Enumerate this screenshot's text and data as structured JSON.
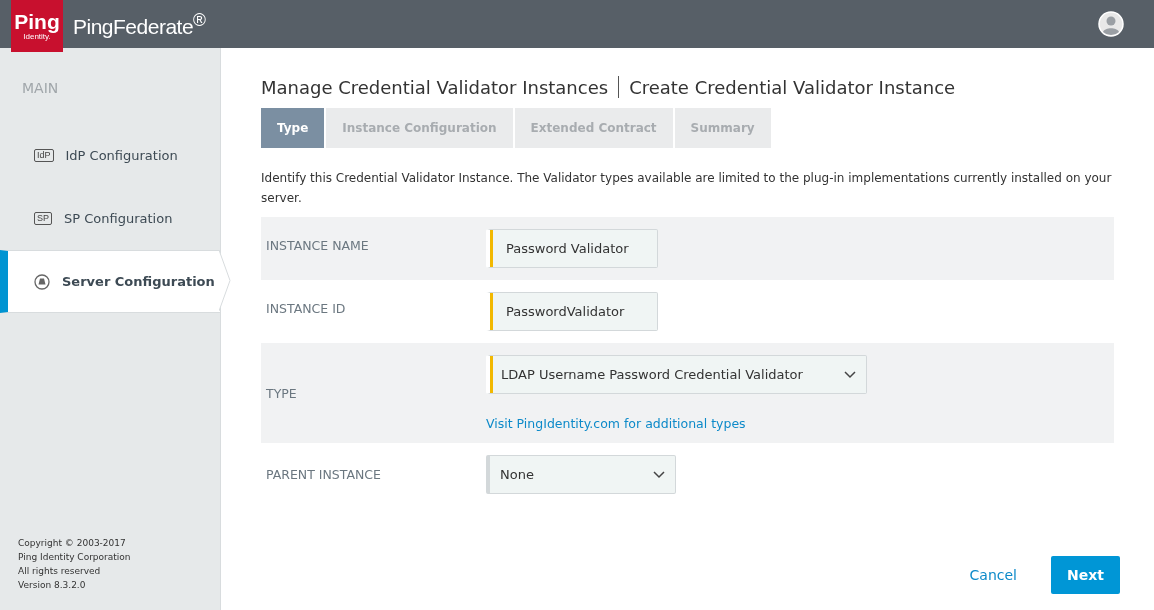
{
  "header": {
    "logo": {
      "word": "Ping",
      "sub": "Identity."
    },
    "product": "PingFederate$^{®}$"
  },
  "sidebar": {
    "section": "MAIN",
    "items": [
      {
        "label": "IdP Configuration",
        "kind": "badge",
        "badge": "IdP",
        "selected": false
      },
      {
        "label": "SP Configuration",
        "kind": "badge",
        "badge": "SP",
        "selected": false
      },
      {
        "label": "Server Configuration",
        "kind": "server",
        "selected": true
      }
    ],
    "footer": [
      "Copyright © 2003-2017",
      "Ping Identity Corporation",
      "All rights reserved",
      "Version 8.3.2.0"
    ]
  },
  "title": {
    "parent": "Manage Credential Validator Instances",
    "current": "Create Credential Validator Instance"
  },
  "tabs": [
    {
      "label": "Type",
      "selected": true
    },
    {
      "label": "Instance Configuration",
      "selected": false
    },
    {
      "label": "Extended Contract",
      "selected": false
    },
    {
      "label": "Summary",
      "selected": false
    }
  ],
  "description": "Identify this Credential Validator Instance. The Validator types available are limited to the plug-in implementations currently installed on your server.",
  "fields": [
    {
      "label": "INSTANCE NAME",
      "kind": "text",
      "value": "Password Validator",
      "required": true
    },
    {
      "label": "INSTANCE ID",
      "kind": "text",
      "value": "PasswordValidator",
      "required": true
    },
    {
      "label": "TYPE",
      "kind": "select",
      "value": "LDAP Username Password Credential Validator",
      "required": true,
      "link": "Visit PingIdentity.com for additional types"
    },
    {
      "label": "PARENT INSTANCE",
      "kind": "select",
      "value": "None",
      "required": false
    }
  ],
  "buttons": {
    "cancel": "Cancel",
    "next": "Next"
  }
}
